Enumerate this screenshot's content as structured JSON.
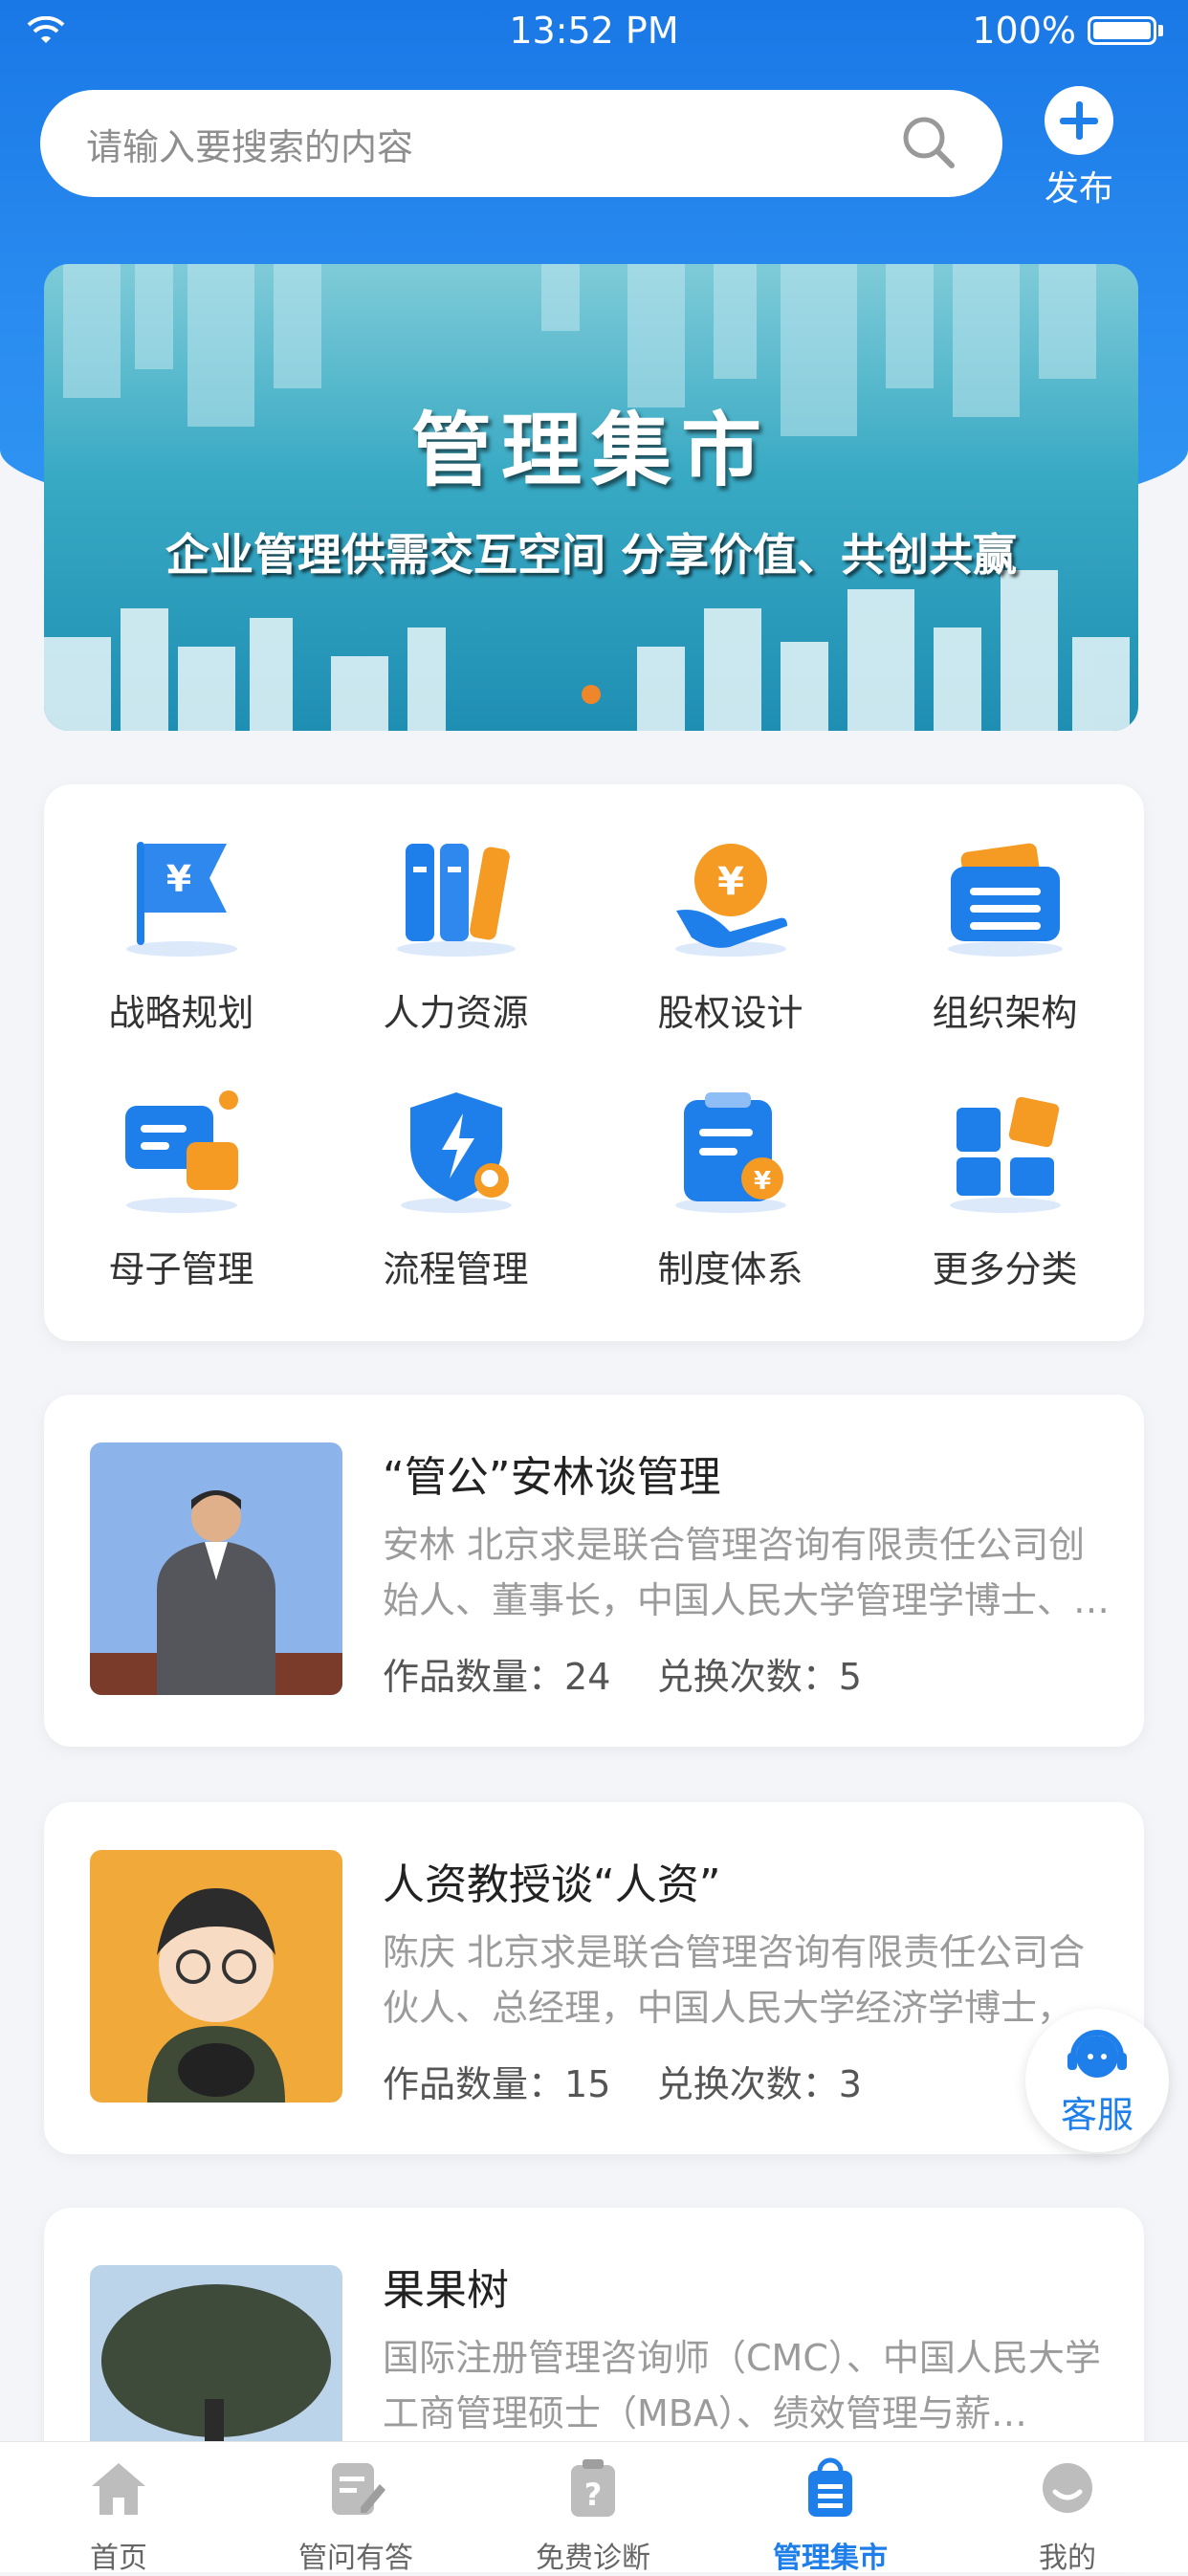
{
  "status_bar": {
    "time": "13:52 PM",
    "battery": "100%"
  },
  "search": {
    "placeholder": "请输入要搜索的内容"
  },
  "publish": {
    "label": "发布"
  },
  "banner": {
    "title": "管理集市",
    "subtitle": "企业管理供需交互空间 分享价值、共创共赢"
  },
  "categories": [
    {
      "label": "战略规划",
      "icon": "flag-yuan-icon"
    },
    {
      "label": "人力资源",
      "icon": "books-icon"
    },
    {
      "label": "股权设计",
      "icon": "coin-hand-icon"
    },
    {
      "label": "组织架构",
      "icon": "wallet-icon"
    },
    {
      "label": "母子管理",
      "icon": "chat-bubbles-icon"
    },
    {
      "label": "流程管理",
      "icon": "shield-bolt-icon"
    },
    {
      "label": "制度体系",
      "icon": "clipboard-yuan-icon"
    },
    {
      "label": "更多分类",
      "icon": "grid-icon"
    }
  ],
  "experts": [
    {
      "title": "“管公”安林谈管理",
      "desc": "安林 北京求是联合管理咨询有限责任公司创始人、董事长，中国人民大学管理学博士、…",
      "works_label": "作品数量：",
      "works": "24",
      "exchange_label": "兑换次数：",
      "exchange": "5"
    },
    {
      "title": "人资教授谈“人资”",
      "desc": "陈庆 北京求是联合管理咨询有限责任公司合伙人、总经理，中国人民大学经济学博士，…",
      "works_label": "作品数量：",
      "works": "15",
      "exchange_label": "兑换次数：",
      "exchange": "3"
    },
    {
      "title": "果果树",
      "desc": "国际注册管理咨询师（CMC）、中国人民大学工商管理硕士（MBA）、绩效管理与薪…",
      "works_label": "",
      "works": "",
      "exchange_label": "",
      "exchange": ""
    }
  ],
  "customer_service": {
    "label": "客服"
  },
  "tabs": [
    {
      "label": "首页",
      "icon": "home-icon"
    },
    {
      "label": "管问有答",
      "icon": "edit-note-icon"
    },
    {
      "label": "免费诊断",
      "icon": "question-clipboard-icon"
    },
    {
      "label": "管理集市",
      "icon": "bag-list-icon",
      "active": true
    },
    {
      "label": "我的",
      "icon": "chat-profile-icon"
    }
  ],
  "colors": {
    "primary": "#1f7fea",
    "orange": "#f0862a",
    "text": "#333333",
    "muted": "#9b9b9b"
  }
}
